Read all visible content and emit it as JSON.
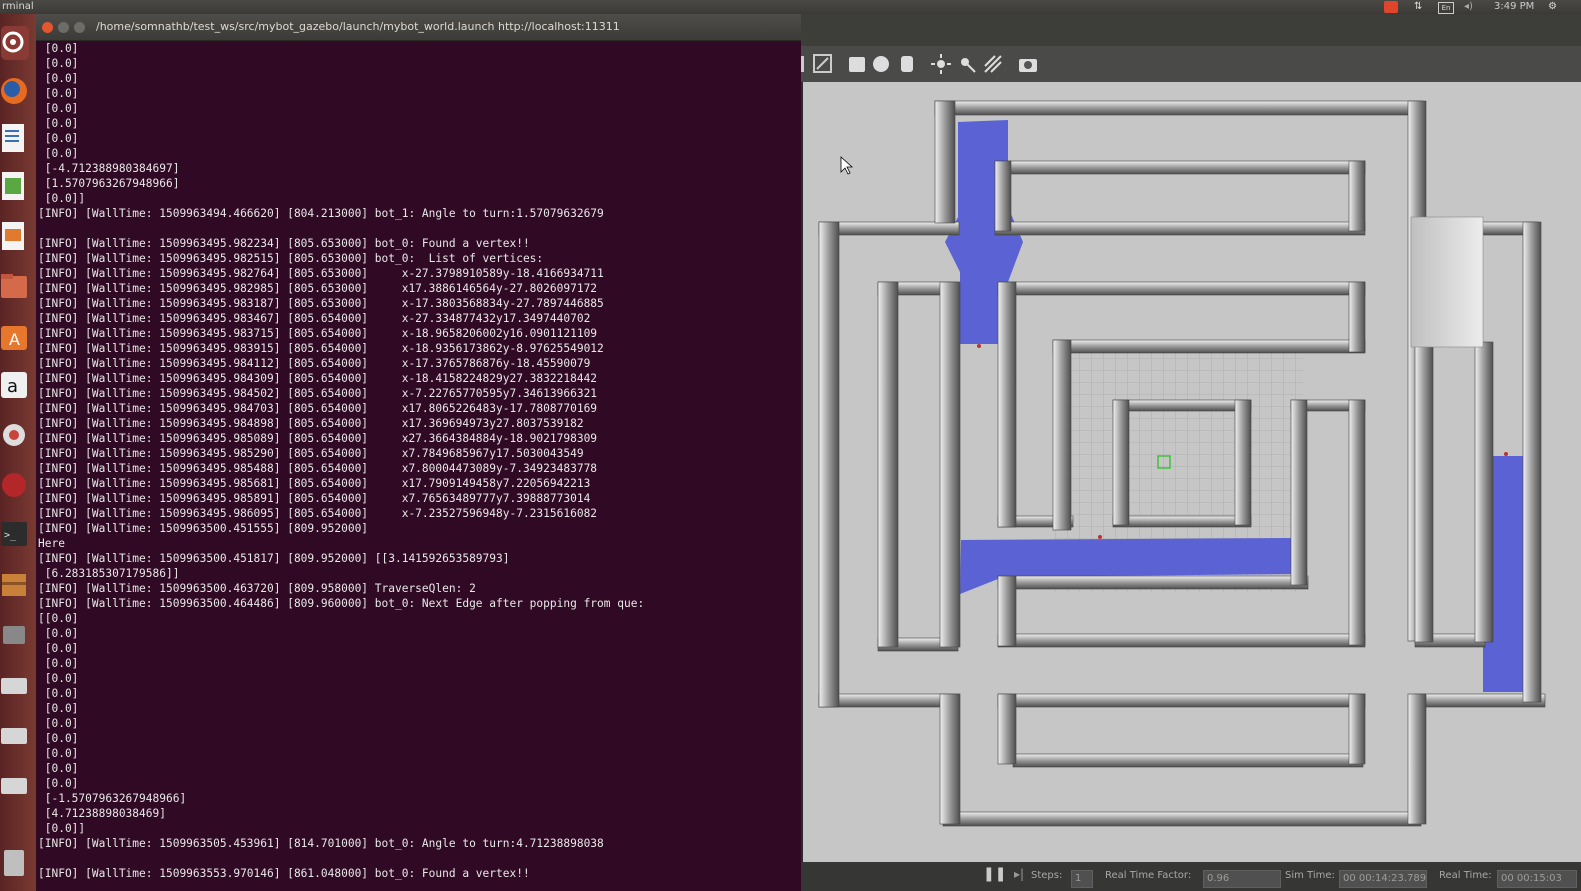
{
  "top_panel": {
    "title": "rminal",
    "clock": "3:49 PM"
  },
  "launcher": {
    "items": [
      "dash-home",
      "firefox",
      "libreoffice-writer",
      "libreoffice-calc",
      "libreoffice-impress",
      "files",
      "software-center",
      "amazon",
      "system-settings",
      "app-red",
      "terminal",
      "package-installer",
      "app-7",
      "drive-1",
      "drive-2",
      "drive-3",
      "trash"
    ]
  },
  "terminal": {
    "title": "/home/somnathb/test_ws/src/mybot_gazebo/launch/mybot_world.launch http://localhost:11311",
    "lines": [
      " [0.0]",
      " [0.0]",
      " [0.0]",
      " [0.0]",
      " [0.0]",
      " [0.0]",
      " [0.0]",
      " [0.0]",
      " [-4.71238898038469​7]",
      " [1.5707963267948966]",
      " [0.0]]",
      "[INFO] [WallTime: 1509963494.466620] [804.213000] bot_1: Angle to turn:1.57079632679",
      "",
      "[INFO] [WallTime: 1509963495.982234] [805.653000] bot_0: Found a vertex!!",
      "[INFO] [WallTime: 1509963495.982515] [805.653000] bot_0:  List of vertices:",
      "[INFO] [WallTime: 1509963495.982764] [805.653000]     x-27.3798910589y-18.4166934711",
      "[INFO] [WallTime: 1509963495.982985] [805.653000]     x17.3886146564y-27.8026097172",
      "[INFO] [WallTime: 1509963495.983187] [805.653000]     x-17.3803568834y-27.7897446885",
      "[INFO] [WallTime: 1509963495.983467] [805.654000]     x-27.334877432y17.3497440702",
      "[INFO] [WallTime: 1509963495.983715] [805.654000]     x-18.9658206002y16.0901121109",
      "[INFO] [WallTime: 1509963495.983915] [805.654000]     x-18.9356173862y-8.97625549012",
      "[INFO] [WallTime: 1509963495.984112] [805.654000]     x-17.3765786876y-18.45590079",
      "[INFO] [WallTime: 1509963495.984309] [805.654000]     x-18.4158224829y27.3832218442",
      "[INFO] [WallTime: 1509963495.984502] [805.654000]     x-7.22765770595y7.34613966321",
      "[INFO] [WallTime: 1509963495.984703] [805.654000]     x17.8065226483y-17.7808770169",
      "[INFO] [WallTime: 1509963495.984898] [805.654000]     x17.369694973y27.8037539182",
      "[INFO] [WallTime: 1509963495.985089] [805.654000]     x27.3664384884y-18.9021798309",
      "[INFO] [WallTime: 1509963495.985290] [805.654000]     x7.7849685967y17.5030043549",
      "[INFO] [WallTime: 1509963495.985488] [805.654000]     x7.80004473089y-7.34923483778",
      "[INFO] [WallTime: 1509963495.985681] [805.654000]     x17.7909149458y7.22056942213",
      "[INFO] [WallTime: 1509963495.985891] [805.654000]     x7.76563489777y7.39888773014",
      "[INFO] [WallTime: 1509963495.986095] [805.654000]     x-7.23527596948y-7.2315616082",
      "[INFO] [WallTime: 1509963500.451555] [809.952000]",
      "Here",
      "[INFO] [WallTime: 1509963500.451817] [809.952000] [[3.141592653589793]",
      " [6.283185307179586]]",
      "[INFO] [WallTime: 1509963500.463720] [809.958000] TraverseQlen: 2",
      "[INFO] [WallTime: 1509963500.464486] [809.960000] bot_0: Next Edge after popping from que:",
      "[[0.0]",
      " [0.0]",
      " [0.0]",
      " [0.0]",
      " [0.0]",
      " [0.0]",
      " [0.0]",
      " [0.0]",
      " [0.0]",
      " [0.0]",
      " [0.0]",
      " [0.0]",
      " [-1.5707963267948966]",
      " [4.71238898038469]",
      " [0.0]]",
      "[INFO] [WallTime: 1509963505.453961] [814.701000] bot_0: Angle to turn:4.71238898038",
      "",
      "[INFO] [WallTime: 1509963553.970146] [861.048000] bot_0: Found a vertex!!"
    ]
  },
  "gazebo": {
    "toolbar_icons": [
      "arrow-icon",
      "translate-icon",
      "box-icon",
      "sphere-icon",
      "cylinder-icon",
      "sun-icon",
      "spot-light-icon",
      "dir-light-icon",
      "camera-icon"
    ],
    "bottom": {
      "steps_label": "Steps:",
      "steps_value": "1",
      "rtf_label": "Real Time Factor:",
      "rtf_value": "0.96",
      "sim_label": "Sim Time:",
      "sim_value": "00 00:14:23.789",
      "real_label": "Real Time:",
      "real_value": "00 00:15:03"
    }
  }
}
